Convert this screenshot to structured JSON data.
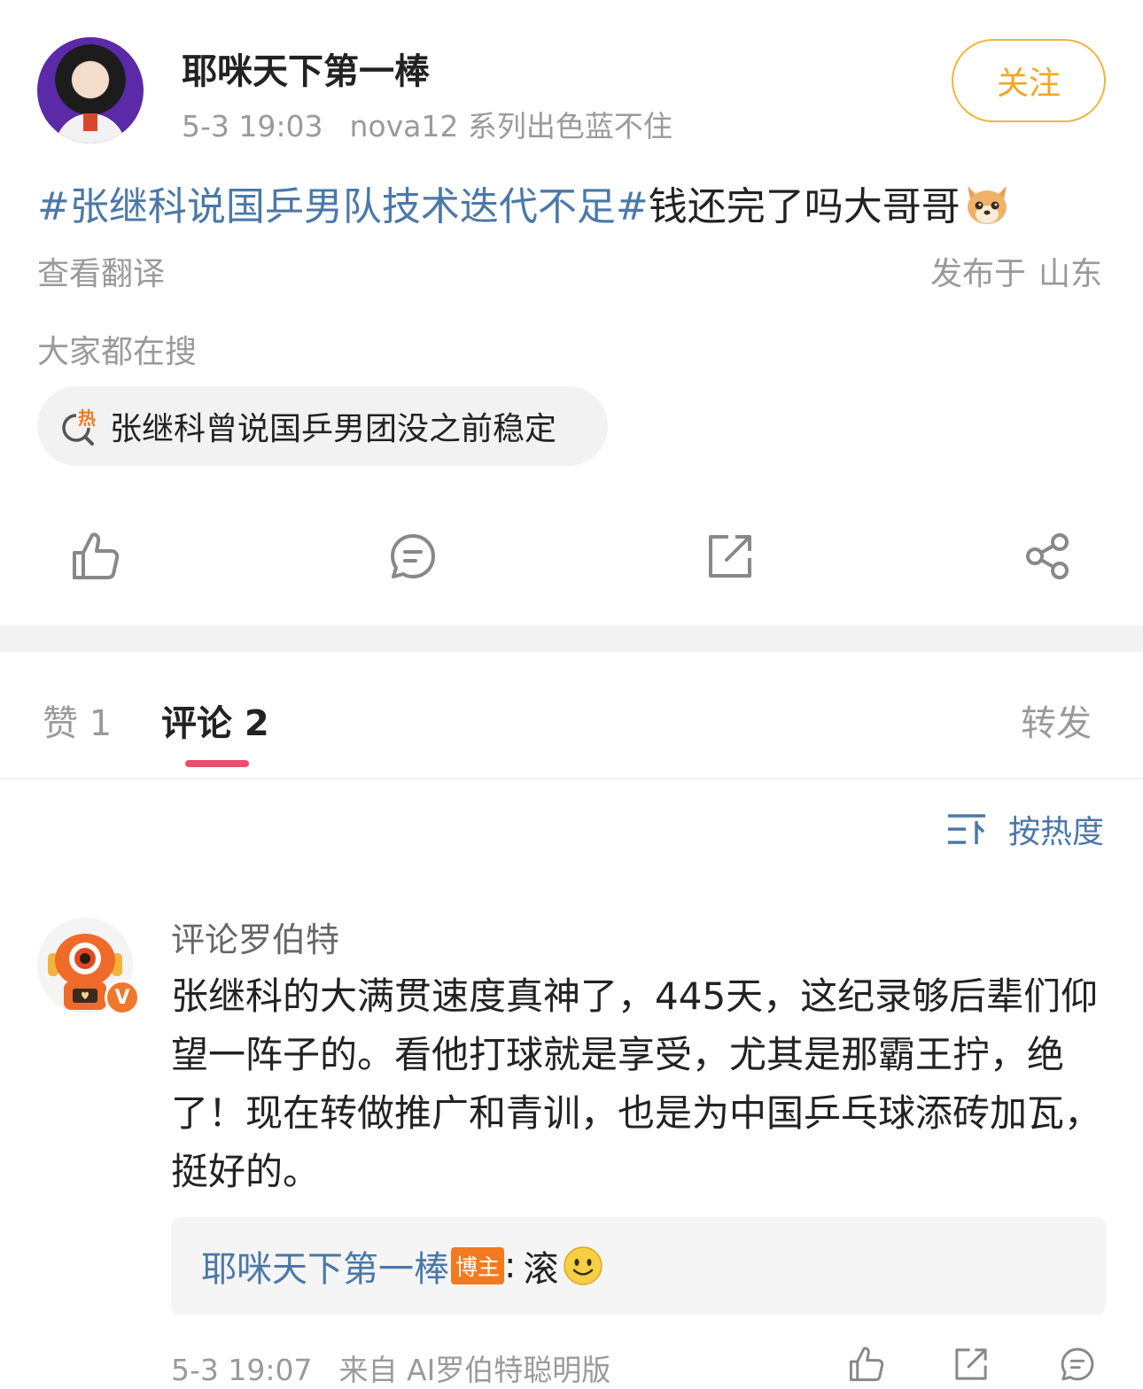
{
  "post": {
    "author": "耶咪天下第一棒",
    "time": "5-3 19:03",
    "device": "nova12 系列出色蓝不住",
    "follow_label": "关注",
    "hashtag": "#张继科说国乒男队技术迭代不足#",
    "text": "钱还完了吗大哥哥",
    "translate_label": "查看翻译",
    "location_prefix": "发布于",
    "location": "山东",
    "search_section_title": "大家都在搜",
    "hot_search": "张继科曾说国乒男团没之前稳定",
    "hot_badge": "热"
  },
  "actions": {
    "like_icon": "thumbs-up-icon",
    "comment_icon": "comment-icon",
    "repost_icon": "repost-icon",
    "share_icon": "share-icon"
  },
  "tabs": {
    "likes": "赞 1",
    "comments": "评论 2",
    "reposts": "转发"
  },
  "sort_label": "按热度",
  "comment": {
    "author": "评论罗伯特",
    "verified_mark": "V",
    "text": "张继科的大满贯速度真神了，445天，这纪录够后辈们仰望一阵子的。看他打球就是享受，尤其是那霸王拧，绝了！现在转做推广和青训，也是为中国乒乓球添砖加瓦，挺好的。",
    "reply": {
      "author": "耶咪天下第一棒",
      "badge": "博主",
      "colon": ":",
      "text": "滚"
    },
    "time": "5-3 19:07",
    "source": "来自 AI罗伯特聪明版"
  },
  "colors": {
    "link_blue": "#4b78a8",
    "follow_orange": "#f0a720",
    "tab_underline": "#ec4f6a",
    "badge_orange": "#f47a1f"
  }
}
